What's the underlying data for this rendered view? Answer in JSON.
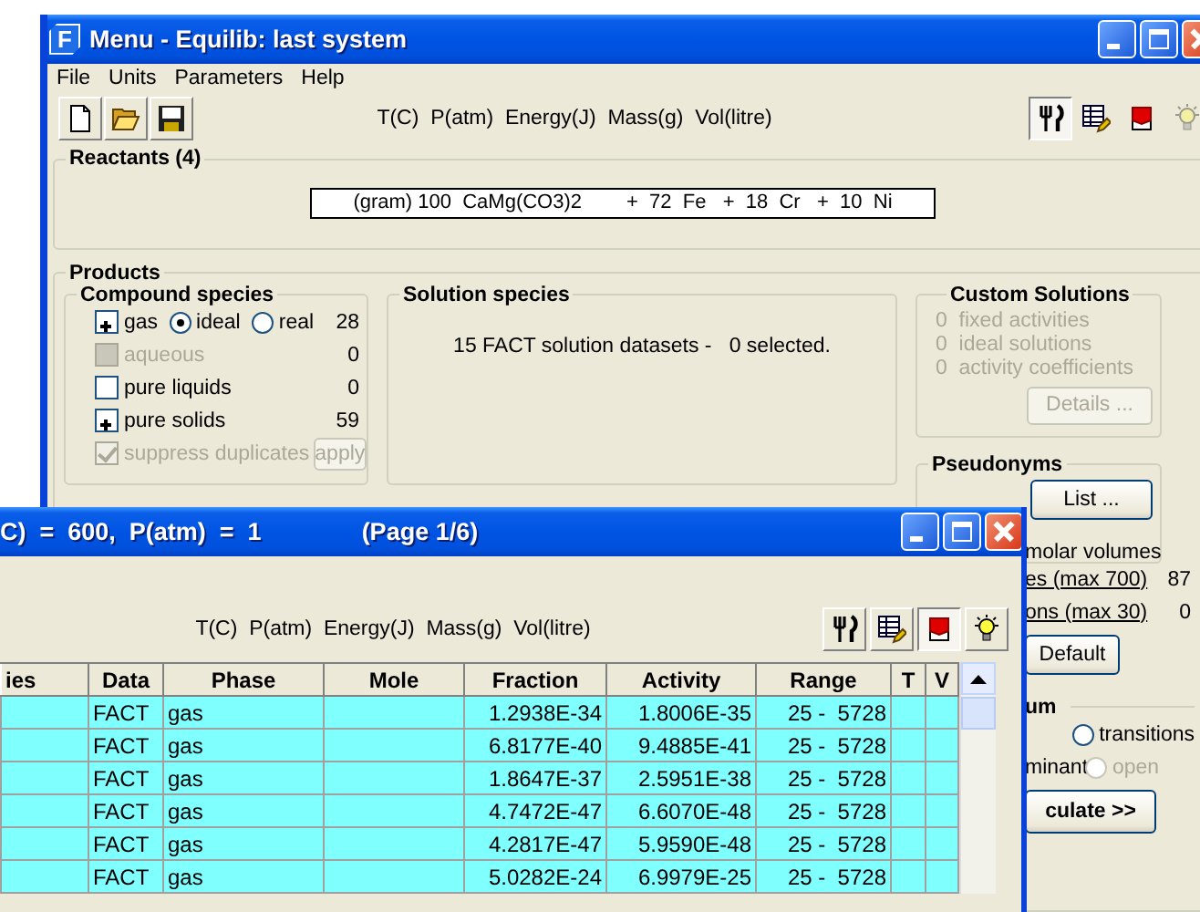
{
  "main_window": {
    "logo": "F",
    "title": "Menu - Equilib: last system",
    "menu": [
      {
        "label": "File"
      },
      {
        "label": "Units"
      },
      {
        "label": "Parameters"
      },
      {
        "label": "Help"
      }
    ],
    "file_tools": [
      {
        "kind": "new"
      },
      {
        "kind": "open"
      },
      {
        "kind": "save"
      }
    ],
    "units": "T(C)  P(atm)  Energy(J)  Mass(g)  Vol(litre)",
    "view_tools": [
      {
        "kind": "cutlery",
        "pressed": true,
        "disabled": false
      },
      {
        "kind": "table",
        "pressed": false,
        "disabled": false
      },
      {
        "kind": "book",
        "pressed": false,
        "disabled": false
      },
      {
        "kind": "bulb",
        "pressed": false,
        "disabled": true
      }
    ],
    "reactants": {
      "title": "Reactants  (4)",
      "value": "(gram) 100  CaMg(CO3)2        +  72  Fe   +  18  Cr   +  10  Ni"
    },
    "products": {
      "title": "Products",
      "compound_species": {
        "title": "Compound species",
        "rows": [
          {
            "label": "gas",
            "checked": true,
            "disabled": false,
            "count": "28",
            "options": [
              {
                "label": "ideal",
                "selected": true
              },
              {
                "label": "real",
                "selected": false
              }
            ]
          },
          {
            "label": "aqueous",
            "checked": false,
            "disabled": true,
            "count": "0"
          },
          {
            "label": "pure liquids",
            "checked": false,
            "disabled": false,
            "count": "0"
          },
          {
            "label": "pure solids",
            "checked": true,
            "disabled": false,
            "count": "59"
          }
        ],
        "suppress_duplicates": {
          "label": "suppress duplicates",
          "checked": true,
          "disabled": true
        },
        "apply_button": {
          "label": "apply",
          "disabled": true
        }
      },
      "solution_species": {
        "title": "Solution species",
        "summary": "15 FACT solution datasets -   0 selected."
      },
      "custom_solutions": {
        "title": "Custom Solutions",
        "disabled": true,
        "items": [
          {
            "count": "0",
            "label": "fixed activities"
          },
          {
            "count": "0",
            "label": "ideal solutions"
          },
          {
            "count": "0",
            "label": "activity coefficients"
          }
        ],
        "details_button": {
          "label": "Details ...",
          "disabled": true
        }
      },
      "pseudonyms": {
        "title": "Pseudonyms",
        "list_button": "List ..."
      },
      "molar_volumes": {
        "title": "molar volumes",
        "limits": [
          {
            "label": "es (max 700)",
            "count": "87"
          },
          {
            "label": "ons (max 30)",
            "count": "0"
          }
        ],
        "default_button": "Default"
      },
      "equilibrium": {
        "title": "um",
        "rows": [
          {
            "options": [
              {
                "label": "transitions",
                "selected": false,
                "disabled": false
              }
            ]
          },
          {
            "label": "minant",
            "options": [
              {
                "label": "open",
                "selected": false,
                "disabled": true
              }
            ]
          }
        ],
        "calculate_button": "culate >>"
      }
    }
  },
  "results_window": {
    "title": "C)  =  600,  P(atm)  =  1",
    "page": "(Page 1/6)",
    "units": "T(C)  P(atm)  Energy(J)  Mass(g)  Vol(litre)",
    "view_tools": [
      {
        "kind": "cutlery",
        "pressed": false,
        "disabled": false
      },
      {
        "kind": "table",
        "pressed": false,
        "disabled": false
      },
      {
        "kind": "book",
        "pressed": true,
        "disabled": false
      },
      {
        "kind": "bulb",
        "pressed": false,
        "disabled": false
      }
    ],
    "table": {
      "columns": [
        "ies",
        "Data",
        "Phase",
        "Mole",
        "Fraction",
        "Activity",
        "Range",
        "T",
        "V"
      ],
      "rows": [
        {
          "data": "FACT",
          "phase": "gas",
          "fraction": "1.2938E-34",
          "activity": "1.8006E-35",
          "range": "25 -  5728"
        },
        {
          "data": "FACT",
          "phase": "gas",
          "fraction": "6.8177E-40",
          "activity": "9.4885E-41",
          "range": "25 -  5728"
        },
        {
          "data": "FACT",
          "phase": "gas",
          "fraction": "1.8647E-37",
          "activity": "2.5951E-38",
          "range": "25 -  5728"
        },
        {
          "data": "FACT",
          "phase": "gas",
          "fraction": "4.7472E-47",
          "activity": "6.6070E-48",
          "range": "25 -  5728"
        },
        {
          "data": "FACT",
          "phase": "gas",
          "fraction": "4.2817E-47",
          "activity": "5.9590E-48",
          "range": "25 -  5728"
        },
        {
          "data": "FACT",
          "phase": "gas",
          "fraction": "5.0282E-24",
          "activity": "6.9979E-25",
          "range": "25 -  5728"
        }
      ]
    }
  }
}
